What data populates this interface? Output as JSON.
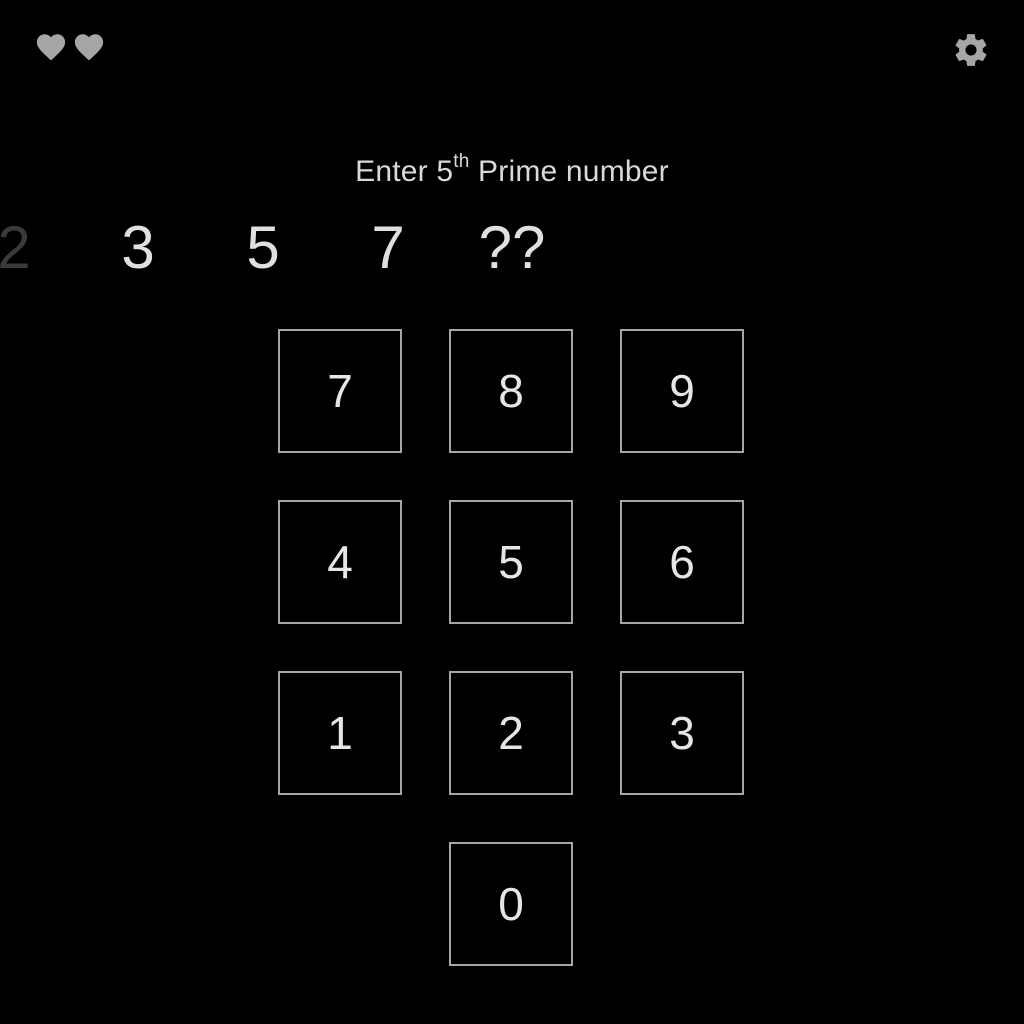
{
  "hud": {
    "lives": [
      "heart-icon",
      "heart-icon"
    ],
    "settings_icon": "gear-icon",
    "icon_color": "#a6a6a6"
  },
  "prompt": {
    "prefix": "Enter 5",
    "ordinal_suffix": "th",
    "suffix": " Prime number"
  },
  "sequence": [
    "2",
    "3",
    "5",
    "7",
    "??"
  ],
  "keypad": {
    "rows": [
      [
        "7",
        "8",
        "9"
      ],
      [
        "4",
        "5",
        "6"
      ],
      [
        "1",
        "2",
        "3"
      ],
      [
        "0"
      ]
    ]
  },
  "colors": {
    "background": "#000000",
    "key_border": "#a6a6a6",
    "text": "#e6e6e6"
  }
}
